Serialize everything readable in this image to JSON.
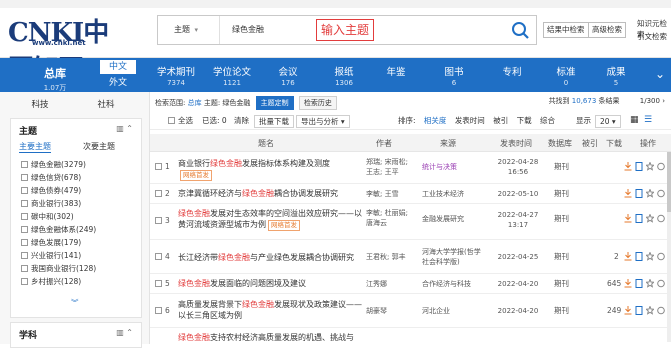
{
  "header": {
    "logo_text": "CNKI中国知网",
    "logo_url": "www.cnki.net",
    "search_field_label": "主题",
    "search_value": "绿色金融",
    "annotation": "输入主题",
    "result_search_label": "结果中检索",
    "advanced_search_label": "高级检索",
    "links": [
      "知识元检索",
      "引文检索"
    ]
  },
  "nav": {
    "main_title": "总库",
    "main_count": "1.07万",
    "lang_cn": "中文",
    "lang_en": "外文",
    "items": [
      {
        "label": "学术期刊",
        "count": "7374"
      },
      {
        "label": "学位论文",
        "count": "1121"
      },
      {
        "label": "会议",
        "count": "176"
      },
      {
        "label": "报纸",
        "count": "1306"
      },
      {
        "label": "年鉴",
        "count": ""
      },
      {
        "label": "图书",
        "count": "6"
      },
      {
        "label": "专利",
        "count": ""
      },
      {
        "label": "标准",
        "count": "0"
      },
      {
        "label": "成果",
        "count": "5"
      }
    ]
  },
  "left": {
    "tabs": [
      "科技",
      "社科"
    ],
    "topic_card": {
      "title": "主题",
      "subtabs": [
        "主要主题",
        "次要主题"
      ],
      "items": [
        "绿色金融(3279)",
        "绿色信贷(678)",
        "绿色债券(479)",
        "商业银行(383)",
        "碳中和(302)",
        "绿色金融体系(249)",
        "绿色发展(179)",
        "兴业银行(141)",
        "我国商业银行(128)",
        "乡村振兴(128)"
      ]
    },
    "subject_card_title": "学科"
  },
  "results": {
    "scope_label": "检索范围:",
    "scope_value": "总库",
    "scope_detail": "主题: 绿色金融",
    "scope_btn_topic": "主题定制",
    "scope_btn_history": "检索历史",
    "count_prefix": "共找到",
    "count_value": "10,673",
    "count_suffix": "条结果",
    "pagination": "1/300",
    "select_all": "全选",
    "selected": "已选: 0",
    "clear": "清除",
    "batch_download": "批量下载",
    "export_analysis": "导出与分析",
    "sort_label": "排序:",
    "sort_opts": [
      "相关度",
      "发表时间",
      "被引",
      "下载",
      "综合"
    ],
    "display_label": "显示",
    "display_value": "20",
    "headers": [
      "题名",
      "作者",
      "来源",
      "发表时间",
      "数据库",
      "被引",
      "下载",
      "操作"
    ],
    "rows": [
      {
        "num": "1",
        "title_pre": "商业银行",
        "title_hl": "绿色金融",
        "title_post": "发展指标体系构建及测度",
        "tag": "网络首发",
        "author": "郑瑞; 宋雨松; 王志; 王平",
        "source": "统计与决策",
        "source_purple": true,
        "date": "2022-04-28 16:56",
        "db": "期刊",
        "cite": "",
        "dl": ""
      },
      {
        "num": "2",
        "title_pre": "京津冀循环经济与",
        "title_hl": "绿色金融",
        "title_post": "耦合协调发展研究",
        "tag": "",
        "author": "李敏; 王雪",
        "source": "工业技术经济",
        "source_purple": false,
        "date": "2022-05-10",
        "db": "期刊",
        "cite": "",
        "dl": ""
      },
      {
        "num": "3",
        "title_pre": "",
        "title_hl": "绿色金融",
        "title_post": "发展对生态效率的空间溢出效应研究——以黄河流域资源型城市为例",
        "tag": "网络首发",
        "author": "李敏; 杜丽娟; 唐海云",
        "source": "金融发展研究",
        "source_purple": false,
        "date": "2022-04-27 13:17",
        "db": "期刊",
        "cite": "",
        "dl": ""
      },
      {
        "num": "4",
        "title_pre": "长江经济带",
        "title_hl": "绿色金融",
        "title_post": "与产业绿色发展耦合协调研究",
        "tag": "",
        "author": "王君秋; 郭丰",
        "source": "河海大学学报(哲学社会科学版)",
        "source_purple": false,
        "date": "2022-04-25",
        "db": "期刊",
        "cite": "",
        "dl": "2"
      },
      {
        "num": "5",
        "title_pre": "",
        "title_hl": "绿色金融",
        "title_post": "发展面临的问题困境及建议",
        "tag": "",
        "author": "江秀娜",
        "source": "合作经济与科技",
        "source_purple": false,
        "date": "2022-04-20",
        "db": "期刊",
        "cite": "",
        "dl": "645"
      },
      {
        "num": "6",
        "title_pre": "高质量发展背景下",
        "title_hl": "绿色金融",
        "title_post": "发展现状及政策建议——以长三角区域为例",
        "tag": "",
        "author": "胡豪琴",
        "source": "河北企业",
        "source_purple": false,
        "date": "2022-04-20",
        "db": "期刊",
        "cite": "",
        "dl": "249"
      },
      {
        "num": "7",
        "title_pre": "",
        "title_hl": "绿色金融",
        "title_post": "支持农村经济高质量发展的机遇、挑战与",
        "tag": "",
        "author": "",
        "source": "",
        "source_purple": false,
        "date": "",
        "db": "",
        "cite": "",
        "dl": ""
      }
    ]
  },
  "colors": {
    "brand_blue": "#1f6fc5",
    "highlight_red": "#e23c3c",
    "tag_orange": "#e67a2e"
  },
  "icons": [
    "search-icon",
    "download-icon",
    "read-icon",
    "favorite-icon",
    "quote-icon",
    "checkbox-icon"
  ]
}
